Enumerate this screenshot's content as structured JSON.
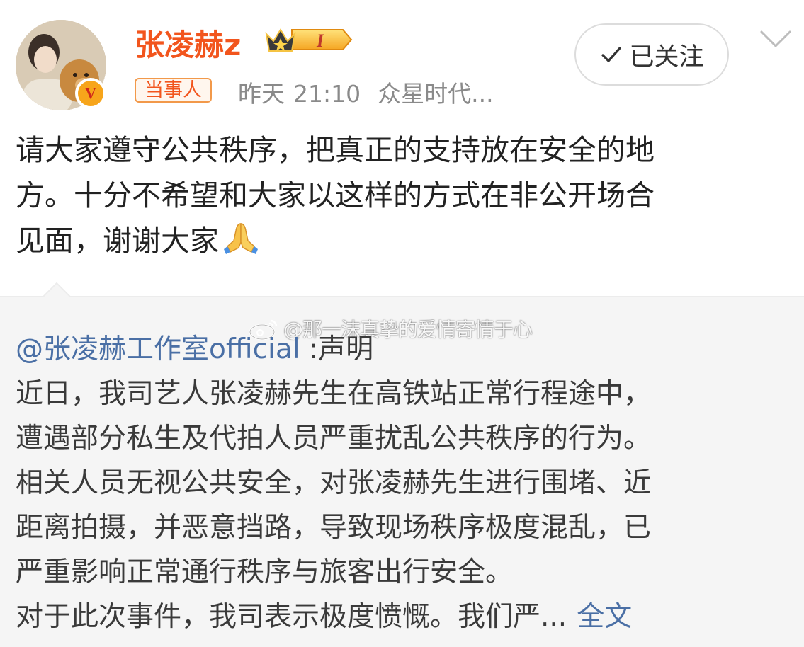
{
  "header": {
    "username": "张凌赫z",
    "member_badge_text": "I",
    "verified_badge_text": "V",
    "tag": "当事人",
    "date": "昨天",
    "time": "21:10",
    "source": "众星时代...",
    "follow_label": "已关注"
  },
  "post": {
    "lines": [
      "请大家遵守公共秩序，把真正的支持放在安全的地",
      "方。十分不希望和大家以这样的方式在非公开场合",
      "见面，谢谢大家"
    ]
  },
  "retweet": {
    "author": "@张凌赫工作室official",
    "author_suffix": " :声明",
    "lines": [
      "近日，我司艺人张凌赫先生在高铁站正常行程途中，",
      "遭遇部分私生及代拍人员严重扰乱公共秩序的行为。",
      "相关人员无视公共安全，对张凌赫先生进行围堵、近",
      "距离拍摄，并恶意挡路，导致现场秩序极度混乱，已",
      "严重影响正常通行秩序与旅客出行安全。",
      "对于此次事件，我司表示极度愤慨。我们严..."
    ],
    "full_text_link": "全文"
  },
  "watermark": {
    "text": "@那一沫真挚的爱情寄情于心"
  },
  "colors": {
    "username": "#f2551d",
    "link": "#4a6fa5",
    "retweet_bg": "#f5f5f5",
    "meta": "#8a8a8a"
  },
  "icons": [
    "avatar",
    "verified-v-icon",
    "crown-level-badge-icon",
    "check-icon",
    "chevron-down-icon",
    "folded-hands-emoji-icon",
    "weibo-logo-icon"
  ]
}
